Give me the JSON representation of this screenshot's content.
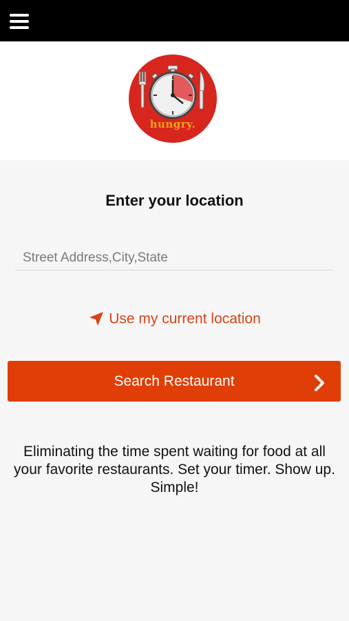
{
  "header": {
    "menu_icon": "hamburger-menu-icon"
  },
  "logo": {
    "text": "hungry.",
    "colors": {
      "disc": "#d7261e",
      "timer_accent": "#e45a5a",
      "text": "#f4a21c"
    }
  },
  "location": {
    "heading": "Enter your location",
    "address_placeholder": "Street Address,City,State",
    "address_value": "",
    "use_current_label": "Use my current location",
    "use_current_icon": "navigation-arrow-icon"
  },
  "search": {
    "button_label": "Search Restaurant",
    "button_icon": "chevron-right-icon"
  },
  "tagline": "Eliminating the time spent waiting for food at all your favorite restaurants. Set your timer. Show up. Simple!",
  "colors": {
    "accent": "#e03e06",
    "link": "#d84315",
    "topbar": "#000000"
  }
}
